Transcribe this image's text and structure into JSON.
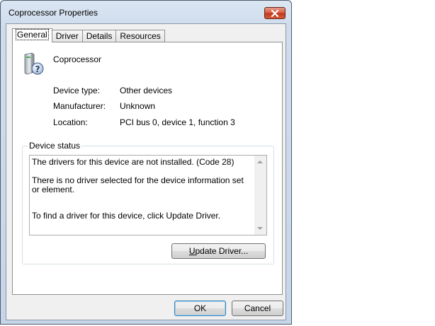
{
  "window": {
    "title": "Coprocessor Properties"
  },
  "tabs": [
    {
      "label": "General"
    },
    {
      "label": "Driver"
    },
    {
      "label": "Details"
    },
    {
      "label": "Resources"
    }
  ],
  "device": {
    "name": "Coprocessor",
    "icon": "unknown-device-icon",
    "properties": [
      {
        "label": "Device type:",
        "value": "Other devices"
      },
      {
        "label": "Manufacturer:",
        "value": "Unknown"
      },
      {
        "label": "Location:",
        "value": "PCI bus 0, device 1, function 3"
      }
    ]
  },
  "status": {
    "group_title": "Device status",
    "line1": "The drivers for this device are not installed. (Code 28)",
    "line2": "There is no driver selected for the device information set or element.",
    "line3": "To find a driver for this device, click Update Driver."
  },
  "buttons": {
    "update_driver_mnemonic": "U",
    "update_driver_rest": "pdate Driver...",
    "ok": "OK",
    "cancel": "Cancel"
  },
  "colors": {
    "close_button": "#c1351b",
    "default_button_border": "#3c7fb1"
  }
}
